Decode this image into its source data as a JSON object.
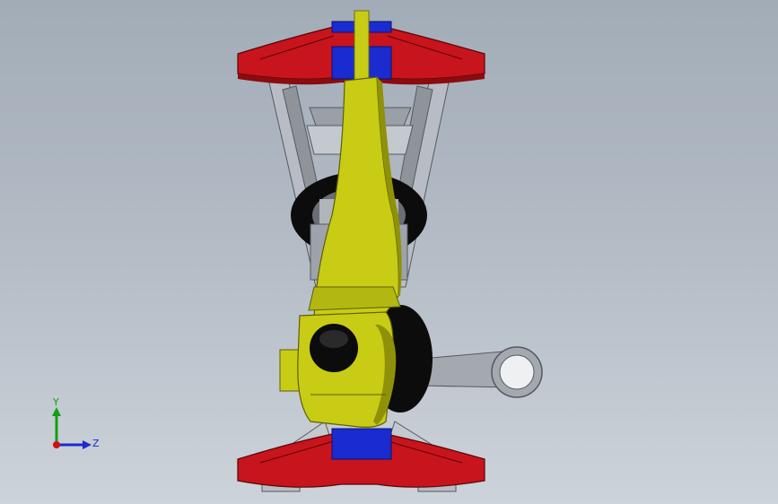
{
  "viewport": {
    "model_name": "mechanical-assembly",
    "colors": {
      "background_top": "#a2acb7",
      "background_bottom": "#cdd3da",
      "red_part": "#c8141c",
      "red_part_dark": "#8a0c10",
      "blue_part": "#1a2bd0",
      "yellow_part": "#c8cc14",
      "yellow_part_dark": "#8f9208",
      "grey_frame": "#b8bcc4",
      "grey_frame_dark": "#6c7078",
      "black_part": "#0c0c0c"
    }
  },
  "triad": {
    "y_label": "Y",
    "z_label": "Z",
    "icons": [
      "y-axis-arrow-icon",
      "z-axis-arrow-icon",
      "x-axis-origin-icon"
    ],
    "colors": {
      "y": "#11a011",
      "z": "#1a2bd0",
      "x": "#d01010"
    }
  }
}
